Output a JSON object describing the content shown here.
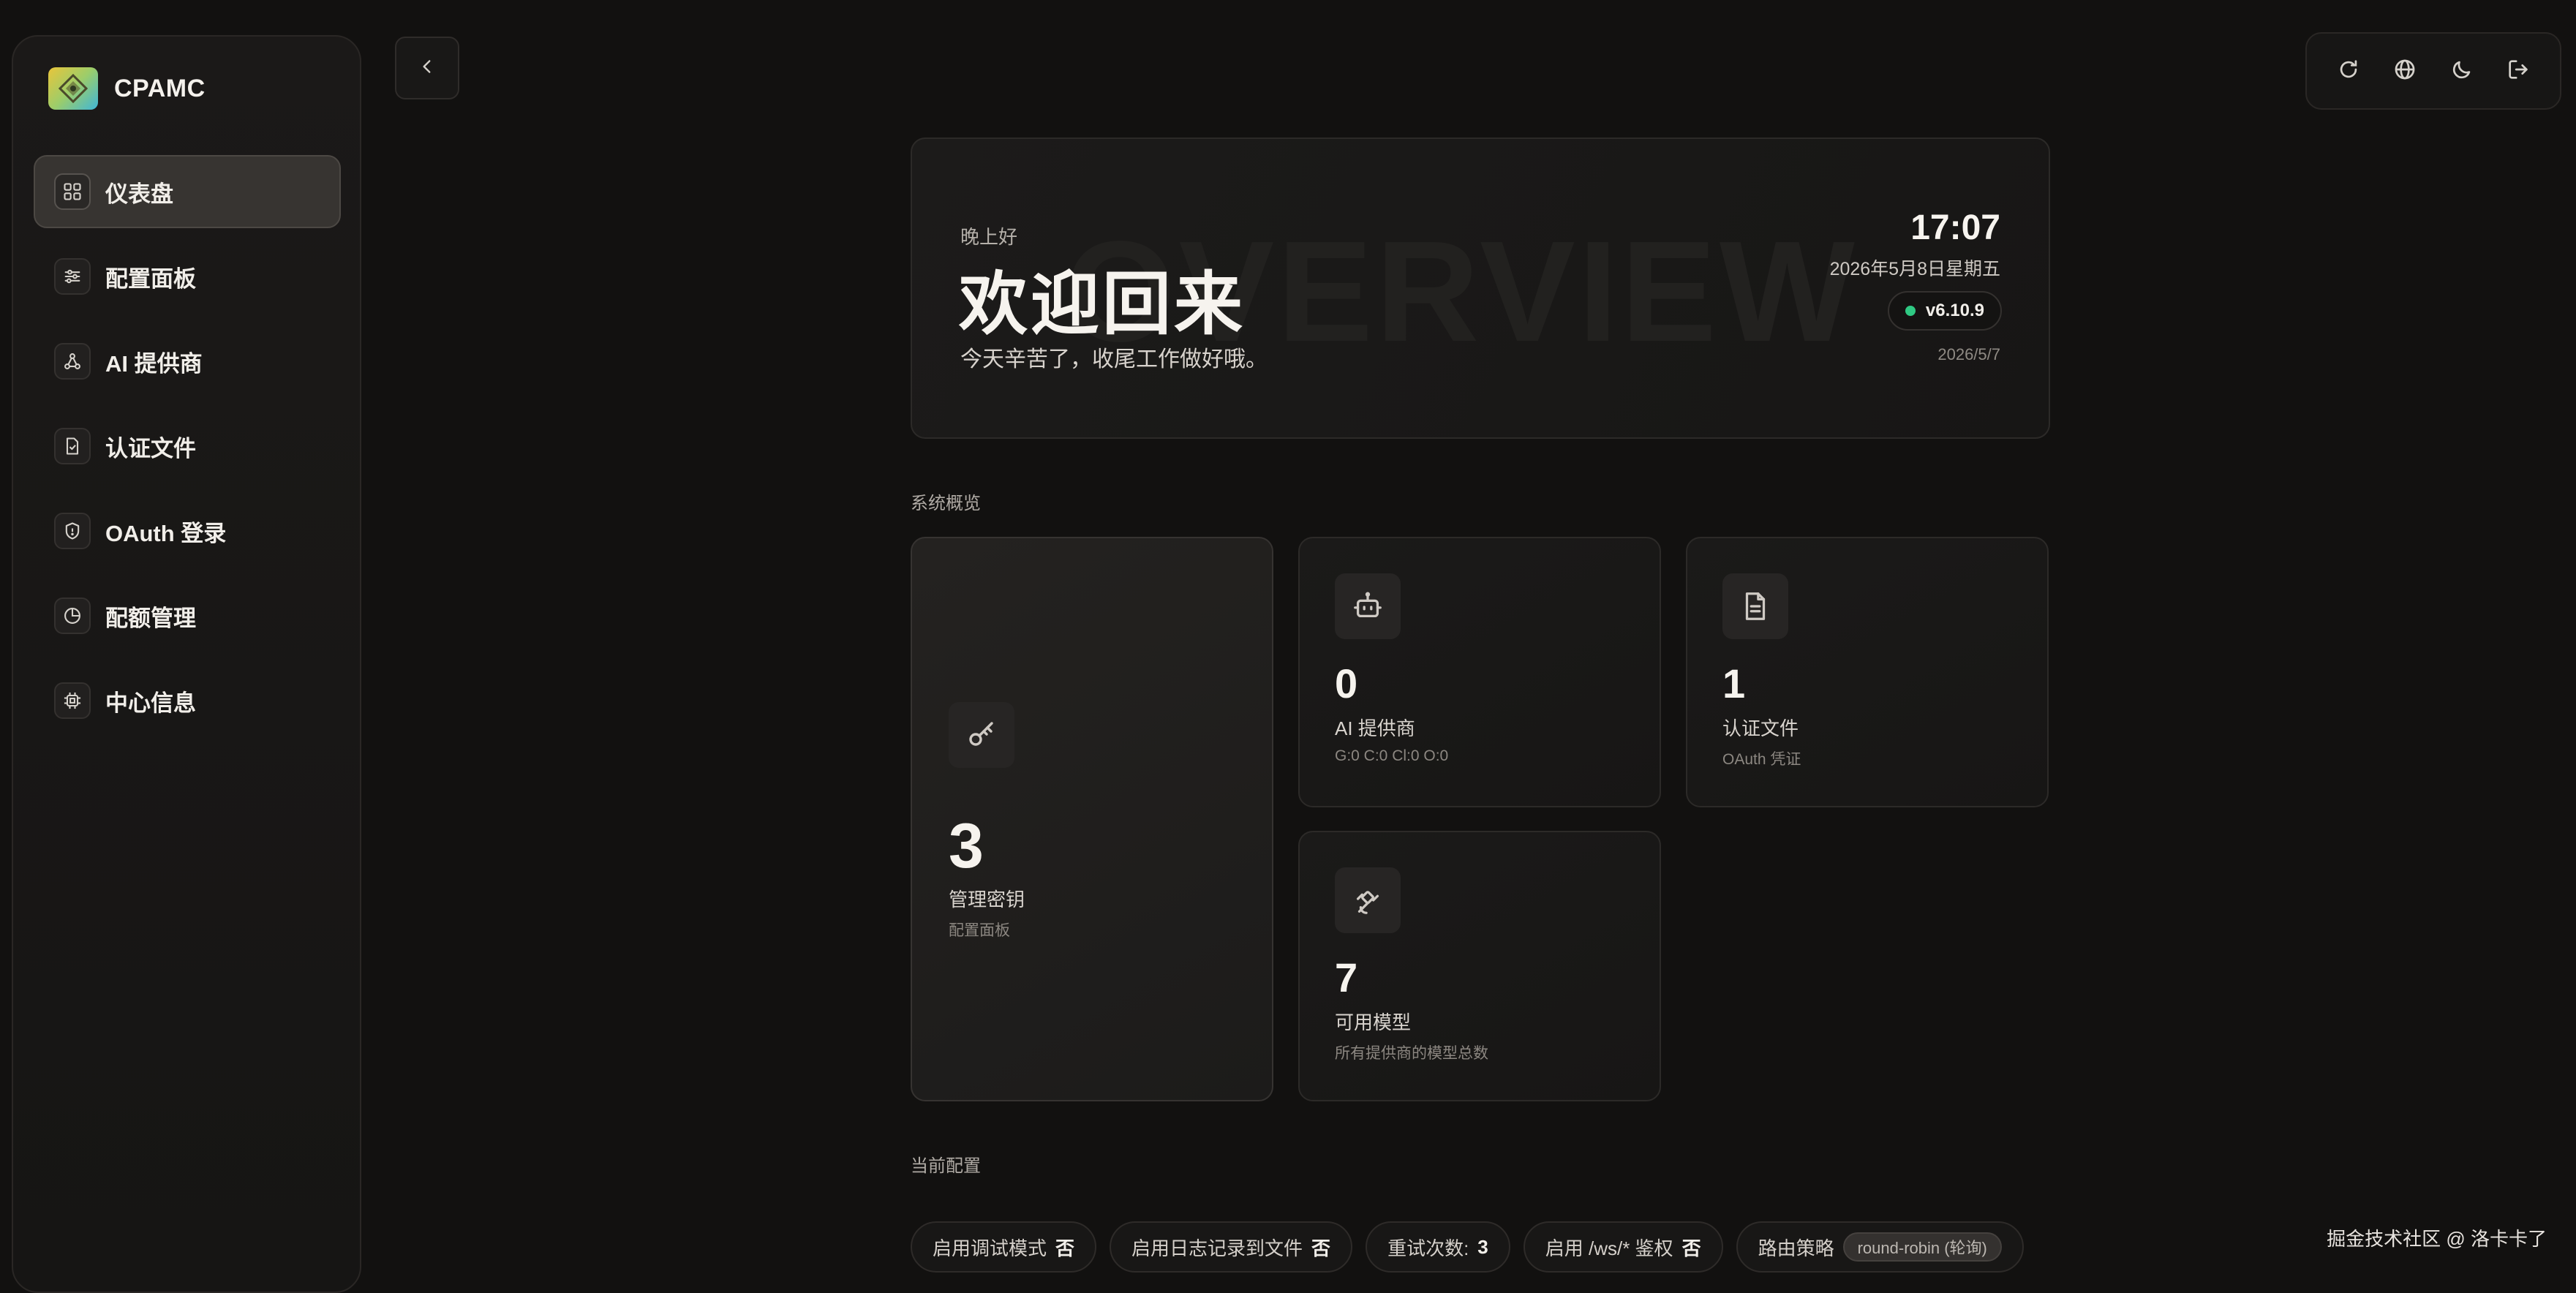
{
  "brand": {
    "name": "CPAMC"
  },
  "sidebar": {
    "items": [
      {
        "label": "仪表盘",
        "icon": "dashboard-grid-icon",
        "active": true
      },
      {
        "label": "配置面板",
        "icon": "sliders-icon"
      },
      {
        "label": "AI 提供商",
        "icon": "network-icon"
      },
      {
        "label": "认证文件",
        "icon": "file-check-icon"
      },
      {
        "label": "OAuth 登录",
        "icon": "shield-icon"
      },
      {
        "label": "配额管理",
        "icon": "pie-chart-icon"
      },
      {
        "label": "中心信息",
        "icon": "cpu-icon"
      }
    ]
  },
  "toolbar": {
    "icons": [
      "refresh-icon",
      "globe-icon",
      "moon-icon",
      "logout-icon"
    ]
  },
  "hero": {
    "watermark": "OVERVIEW",
    "greeting": "晚上好",
    "title": "欢迎回来",
    "subtitle": "今天辛苦了，收尾工作做好哦。",
    "time": "17:07",
    "date": "2026年5月8日星期五",
    "version": "v6.10.9",
    "build_date": "2026/5/7"
  },
  "overview": {
    "section_title": "系统概览",
    "cards": {
      "keys": {
        "value": "3",
        "label": "管理密钥",
        "sub": "配置面板",
        "icon": "key-icon"
      },
      "providers": {
        "value": "0",
        "label": "AI 提供商",
        "sub": "G:0 C:0 Cl:0 O:0",
        "icon": "bot-icon"
      },
      "auth_files": {
        "value": "1",
        "label": "认证文件",
        "sub": "OAuth 凭证",
        "icon": "document-icon"
      },
      "models": {
        "value": "7",
        "label": "可用模型",
        "sub": "所有提供商的模型总数",
        "icon": "satellite-icon"
      }
    }
  },
  "config": {
    "section_title": "当前配置",
    "chips": [
      {
        "label": "启用调试模式",
        "value": "否"
      },
      {
        "label": "启用日志记录到文件",
        "value": "否"
      },
      {
        "label": "重试次数:",
        "value": "3"
      },
      {
        "label": "启用 /ws/* 鉴权",
        "value": "否"
      },
      {
        "label": "路由策略",
        "pill": "round-robin (轮询)"
      }
    ]
  },
  "footer": {
    "credit": "掘金技术社区 @ 洛卡卡了"
  },
  "colors": {
    "status_dot": "#2fc983",
    "active_nav_bg": "#373431",
    "background": "#121110"
  }
}
